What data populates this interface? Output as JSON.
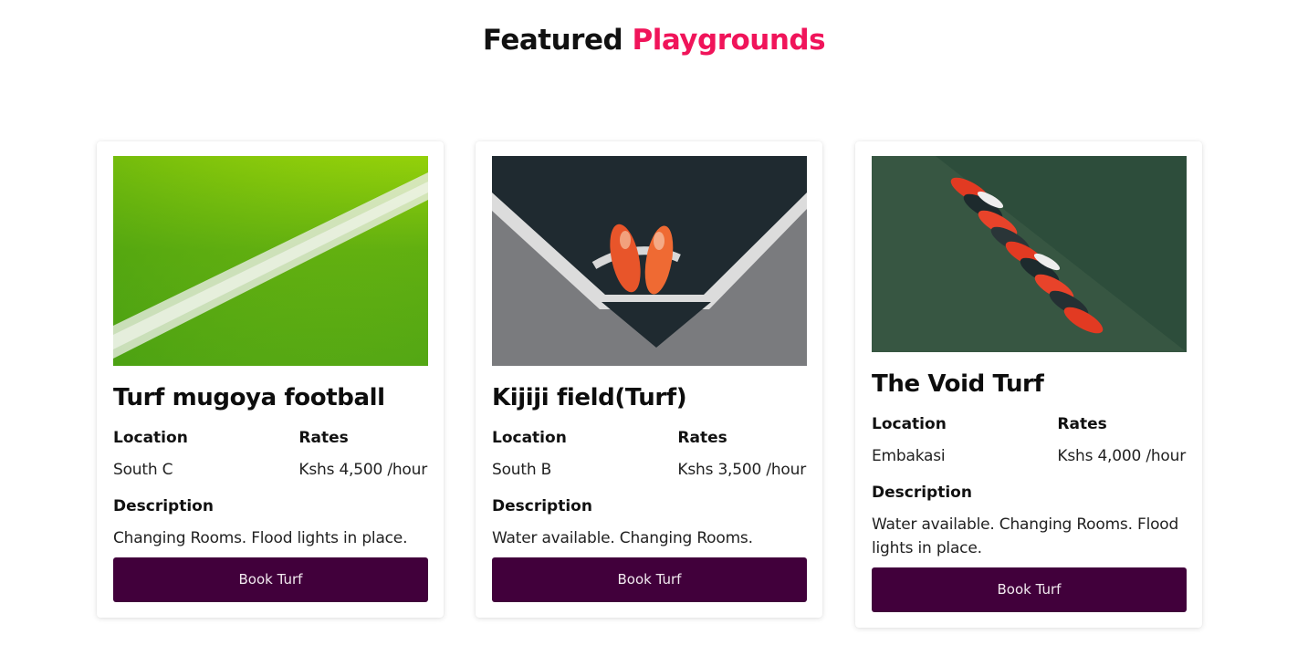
{
  "heading": {
    "prefix": "Featured",
    "accent": "Playgrounds",
    "accent_color": "#f0145a"
  },
  "cards": [
    {
      "image_icon": "grass-field-line-photo",
      "title": "Turf mugoya football",
      "location_label": "Location",
      "location": "South C",
      "rates_label": "Rates",
      "rates": "Kshs 4,500 /hour",
      "description_label": "Description",
      "description": "Changing Rooms. Flood lights in place.",
      "button": "Book Turf"
    },
    {
      "image_icon": "boots-on-corner-photo",
      "title": "Kijiji field(Turf)",
      "location_label": "Location",
      "location": "South B",
      "rates_label": "Rates",
      "rates": "Kshs 3,500 /hour",
      "description_label": "Description",
      "description": "Water available. Changing Rooms.",
      "button": "Book Turf"
    },
    {
      "image_icon": "row-of-boots-photo",
      "title": "The Void Turf",
      "location_label": "Location",
      "location": "Embakasi",
      "rates_label": "Rates",
      "rates": "Kshs 4,000 /hour",
      "description_label": "Description",
      "description": "Water available. Changing Rooms. Flood lights in place.",
      "button": "Book Turf"
    }
  ],
  "colors": {
    "button_bg": "#41003b",
    "accent": "#f0145a"
  }
}
